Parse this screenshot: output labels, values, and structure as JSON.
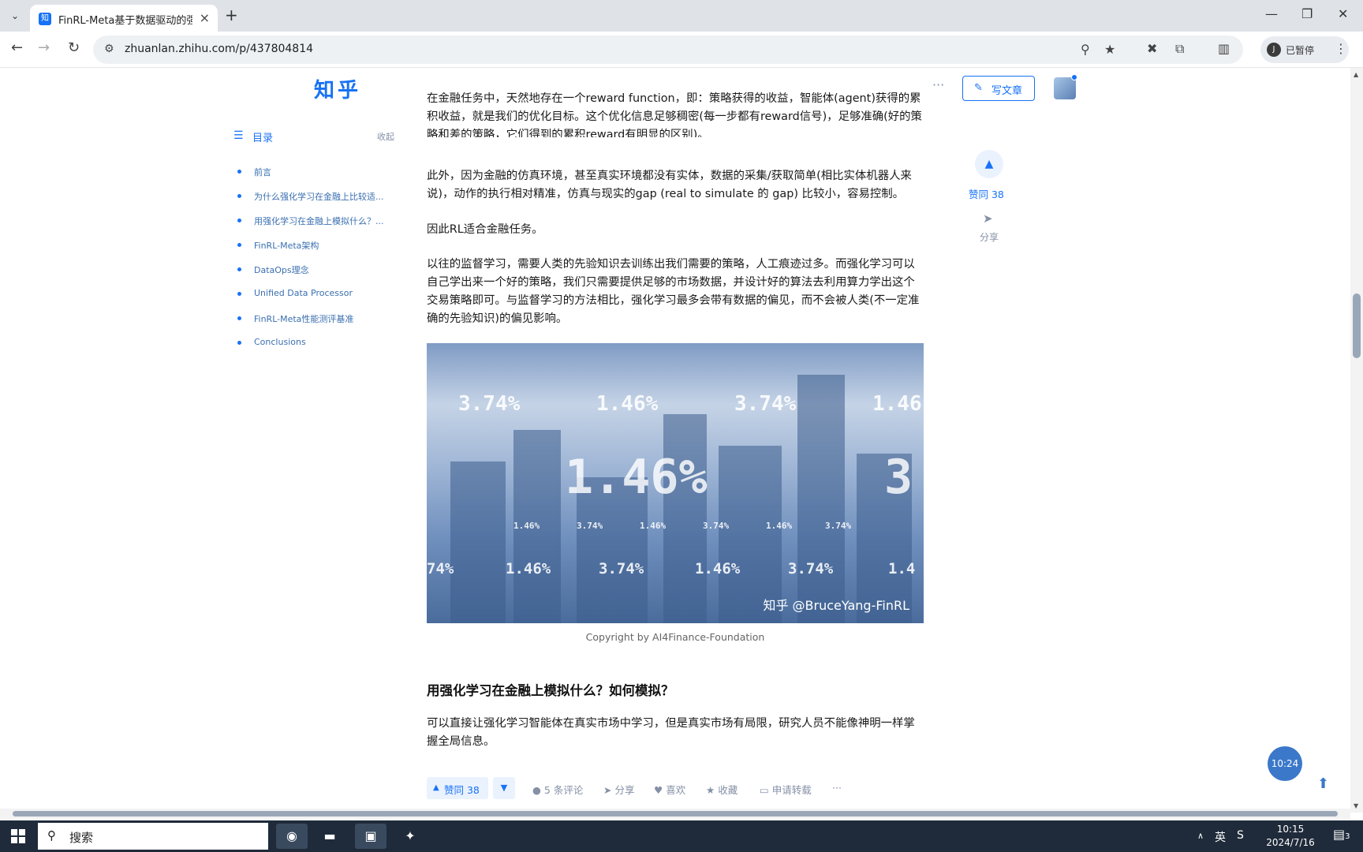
{
  "browser": {
    "tab_title": "FinRL-Meta基于数据驱动的强",
    "favicon_text": "知",
    "url": "zhuanlan.zhihu.com/p/437804814",
    "profile_initial": "J",
    "profile_label": "已暂停"
  },
  "header": {
    "logo": "知乎",
    "more": "···",
    "write_button": "写文章"
  },
  "toc": {
    "title": "目录",
    "collapse": "收起",
    "items": [
      "前言",
      "为什么强化学习在金融上比较适...",
      "用强化学习在金融上模拟什么？...",
      "FinRL-Meta架构",
      "DataOps理念",
      "Unified Data Processor",
      "FinRL-Meta性能测评基准",
      "Conclusions"
    ]
  },
  "article": {
    "p0": "在金融任务中，天然地存在一个reward function，即：策略获得的收益，智能体(agent)获得的累积收益，就是我们的优化目标。这个优化信息足够稠密(每一步都有reward信号)，足够准确(好的策略和差的策略，它们得到的累积reward有明显的区别)。",
    "p1": "此外，因为金融的仿真环境，甚至真实环境都没有实体，数据的采集/获取简单(相比实体机器人来说)，动作的执行相对精准，仿真与现实的gap (real to simulate 的 gap) 比较小，容易控制。",
    "p2": "因此RL适合金融任务。",
    "p3": "以往的监督学习，需要人类的先验知识去训练出我们需要的策略，人工痕迹过多。而强化学习可以自己学出来一个好的策略，我们只需要提供足够的市场数据，并设计好的算法去利用算力学出这个交易策略即可。与监督学习的方法相比，强化学习最多会带有数据的偏见，而不会被人类(不一定准确的先验知识)的偏见影响。",
    "figure_numbers": {
      "row1": [
        "3.74%",
        "1.46%",
        "3.74%",
        "1.46"
      ],
      "big": [
        "1.46%",
        "3"
      ],
      "small": [
        "1.46%",
        "3.74%",
        "1.46%",
        "3.74%",
        "1.46%",
        "3.74%"
      ],
      "row3": [
        "74%",
        "1.46%",
        "3.74%",
        "1.46%",
        "3.74%",
        "1.4"
      ]
    },
    "figure_watermark": "知乎 @BruceYang-FinRL",
    "caption": "Copyright by AI4Finance-Foundation",
    "heading": "用强化学习在金融上模拟什么？如何模拟？",
    "p4": "可以直接让强化学习智能体在真实市场中学习，但是真实市场有局限，研究人员不能像神明一样掌握全局信息。"
  },
  "side_actions": {
    "vote_label": "赞同 38",
    "share_label": "分享"
  },
  "action_bar": {
    "vote": "赞同 38",
    "comments": "5 条评论",
    "share": "分享",
    "like": "喜欢",
    "collect": "收藏",
    "repost": "申请转载",
    "more": "···"
  },
  "floating": {
    "time": "10:24"
  },
  "taskbar": {
    "search_placeholder": "搜索",
    "ime": "英",
    "time": "10:15",
    "date": "2024/7/16",
    "notifications": "3"
  },
  "colors": {
    "brand": "#1772f6",
    "taskbar": "#1f2b3a"
  }
}
